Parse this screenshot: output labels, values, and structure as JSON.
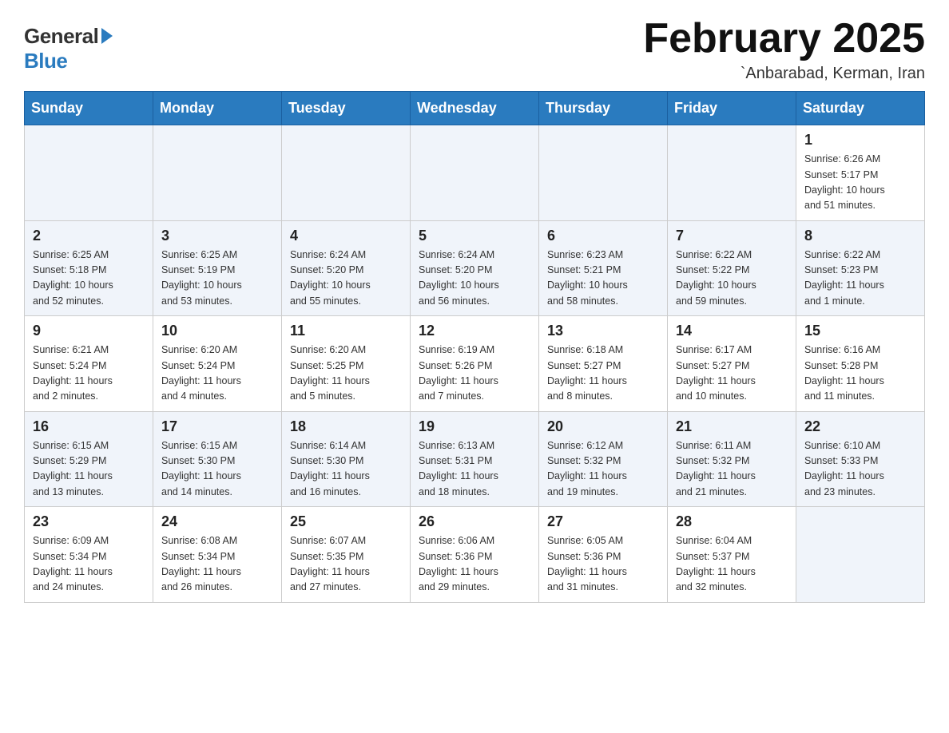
{
  "header": {
    "logo_general": "General",
    "logo_blue": "Blue",
    "month_title": "February 2025",
    "location": "`Anbarabad, Kerman, Iran"
  },
  "days_of_week": [
    "Sunday",
    "Monday",
    "Tuesday",
    "Wednesday",
    "Thursday",
    "Friday",
    "Saturday"
  ],
  "weeks": [
    [
      {
        "day": "",
        "info": ""
      },
      {
        "day": "",
        "info": ""
      },
      {
        "day": "",
        "info": ""
      },
      {
        "day": "",
        "info": ""
      },
      {
        "day": "",
        "info": ""
      },
      {
        "day": "",
        "info": ""
      },
      {
        "day": "1",
        "info": "Sunrise: 6:26 AM\nSunset: 5:17 PM\nDaylight: 10 hours\nand 51 minutes."
      }
    ],
    [
      {
        "day": "2",
        "info": "Sunrise: 6:25 AM\nSunset: 5:18 PM\nDaylight: 10 hours\nand 52 minutes."
      },
      {
        "day": "3",
        "info": "Sunrise: 6:25 AM\nSunset: 5:19 PM\nDaylight: 10 hours\nand 53 minutes."
      },
      {
        "day": "4",
        "info": "Sunrise: 6:24 AM\nSunset: 5:20 PM\nDaylight: 10 hours\nand 55 minutes."
      },
      {
        "day": "5",
        "info": "Sunrise: 6:24 AM\nSunset: 5:20 PM\nDaylight: 10 hours\nand 56 minutes."
      },
      {
        "day": "6",
        "info": "Sunrise: 6:23 AM\nSunset: 5:21 PM\nDaylight: 10 hours\nand 58 minutes."
      },
      {
        "day": "7",
        "info": "Sunrise: 6:22 AM\nSunset: 5:22 PM\nDaylight: 10 hours\nand 59 minutes."
      },
      {
        "day": "8",
        "info": "Sunrise: 6:22 AM\nSunset: 5:23 PM\nDaylight: 11 hours\nand 1 minute."
      }
    ],
    [
      {
        "day": "9",
        "info": "Sunrise: 6:21 AM\nSunset: 5:24 PM\nDaylight: 11 hours\nand 2 minutes."
      },
      {
        "day": "10",
        "info": "Sunrise: 6:20 AM\nSunset: 5:24 PM\nDaylight: 11 hours\nand 4 minutes."
      },
      {
        "day": "11",
        "info": "Sunrise: 6:20 AM\nSunset: 5:25 PM\nDaylight: 11 hours\nand 5 minutes."
      },
      {
        "day": "12",
        "info": "Sunrise: 6:19 AM\nSunset: 5:26 PM\nDaylight: 11 hours\nand 7 minutes."
      },
      {
        "day": "13",
        "info": "Sunrise: 6:18 AM\nSunset: 5:27 PM\nDaylight: 11 hours\nand 8 minutes."
      },
      {
        "day": "14",
        "info": "Sunrise: 6:17 AM\nSunset: 5:27 PM\nDaylight: 11 hours\nand 10 minutes."
      },
      {
        "day": "15",
        "info": "Sunrise: 6:16 AM\nSunset: 5:28 PM\nDaylight: 11 hours\nand 11 minutes."
      }
    ],
    [
      {
        "day": "16",
        "info": "Sunrise: 6:15 AM\nSunset: 5:29 PM\nDaylight: 11 hours\nand 13 minutes."
      },
      {
        "day": "17",
        "info": "Sunrise: 6:15 AM\nSunset: 5:30 PM\nDaylight: 11 hours\nand 14 minutes."
      },
      {
        "day": "18",
        "info": "Sunrise: 6:14 AM\nSunset: 5:30 PM\nDaylight: 11 hours\nand 16 minutes."
      },
      {
        "day": "19",
        "info": "Sunrise: 6:13 AM\nSunset: 5:31 PM\nDaylight: 11 hours\nand 18 minutes."
      },
      {
        "day": "20",
        "info": "Sunrise: 6:12 AM\nSunset: 5:32 PM\nDaylight: 11 hours\nand 19 minutes."
      },
      {
        "day": "21",
        "info": "Sunrise: 6:11 AM\nSunset: 5:32 PM\nDaylight: 11 hours\nand 21 minutes."
      },
      {
        "day": "22",
        "info": "Sunrise: 6:10 AM\nSunset: 5:33 PM\nDaylight: 11 hours\nand 23 minutes."
      }
    ],
    [
      {
        "day": "23",
        "info": "Sunrise: 6:09 AM\nSunset: 5:34 PM\nDaylight: 11 hours\nand 24 minutes."
      },
      {
        "day": "24",
        "info": "Sunrise: 6:08 AM\nSunset: 5:34 PM\nDaylight: 11 hours\nand 26 minutes."
      },
      {
        "day": "25",
        "info": "Sunrise: 6:07 AM\nSunset: 5:35 PM\nDaylight: 11 hours\nand 27 minutes."
      },
      {
        "day": "26",
        "info": "Sunrise: 6:06 AM\nSunset: 5:36 PM\nDaylight: 11 hours\nand 29 minutes."
      },
      {
        "day": "27",
        "info": "Sunrise: 6:05 AM\nSunset: 5:36 PM\nDaylight: 11 hours\nand 31 minutes."
      },
      {
        "day": "28",
        "info": "Sunrise: 6:04 AM\nSunset: 5:37 PM\nDaylight: 11 hours\nand 32 minutes."
      },
      {
        "day": "",
        "info": ""
      }
    ]
  ]
}
